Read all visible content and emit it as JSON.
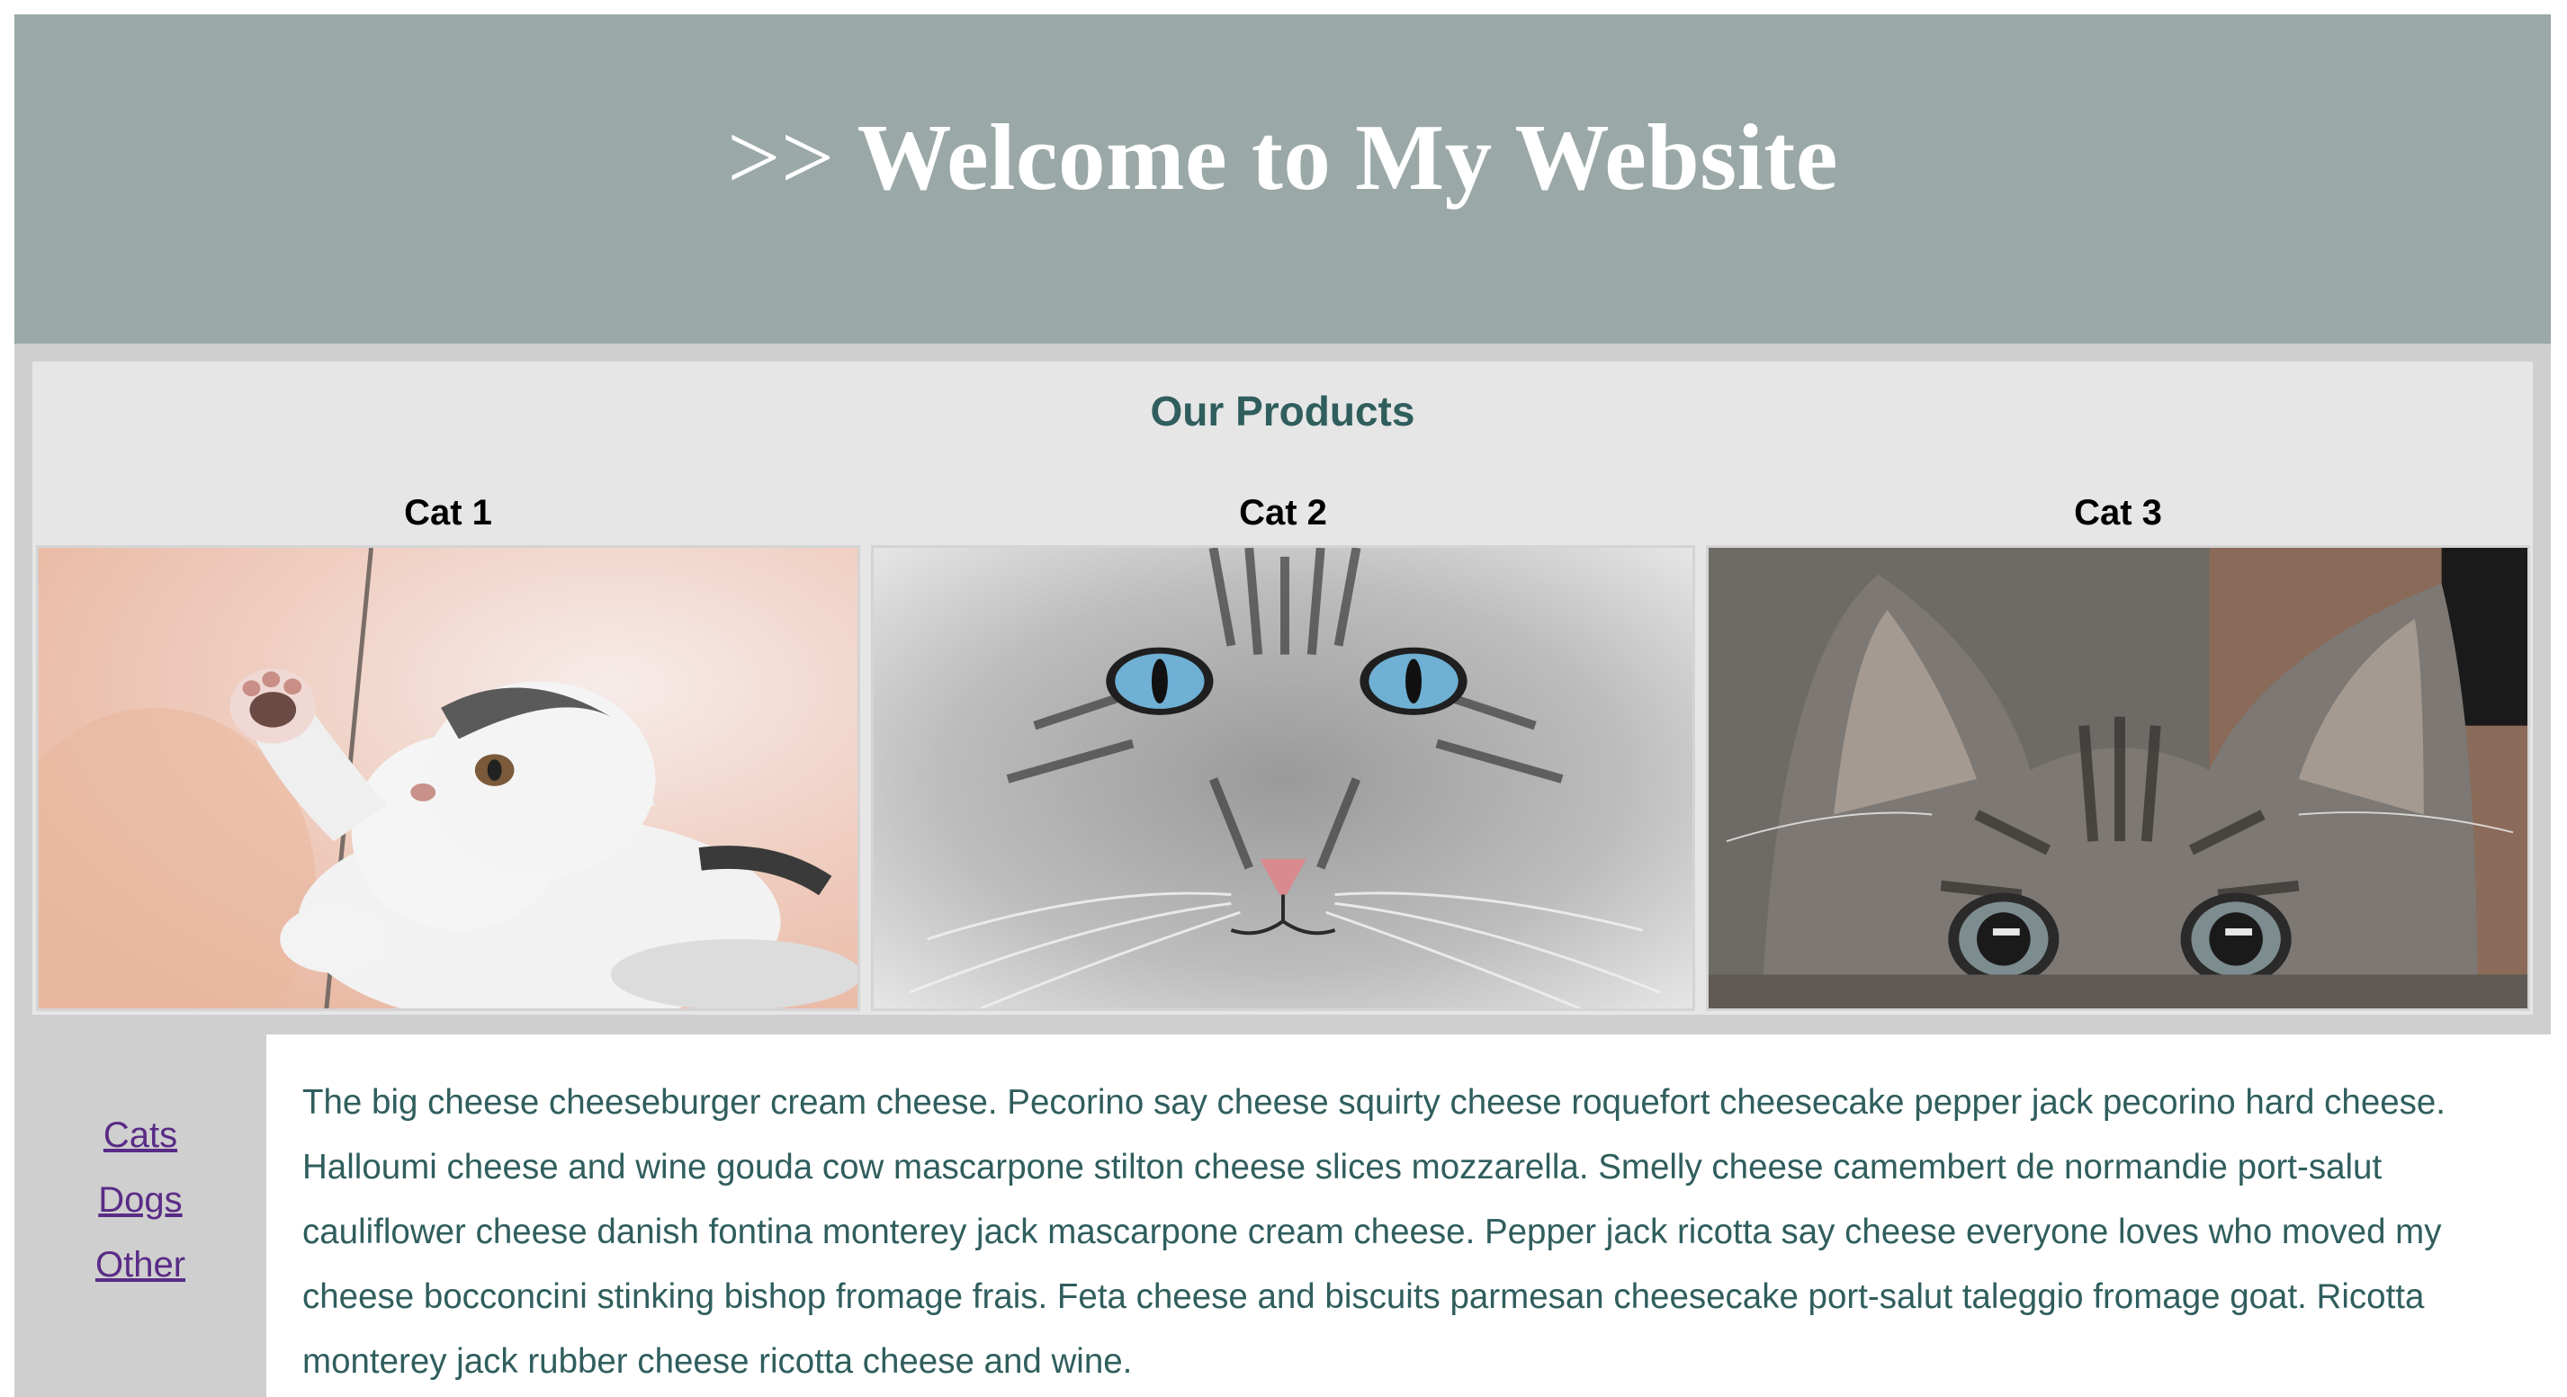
{
  "header": {
    "prefix": ">>",
    "title": "Welcome to My Website"
  },
  "products": {
    "heading": "Our Products",
    "items": [
      {
        "title": "Cat 1",
        "image": "white kitten playing with string"
      },
      {
        "title": "Cat 2",
        "image": "grey tabby cat with blue eyes"
      },
      {
        "title": "Cat 3",
        "image": "tabby kitten peeking over edge"
      }
    ]
  },
  "sidebar": {
    "links": [
      {
        "label": "Cats"
      },
      {
        "label": "Dogs"
      },
      {
        "label": "Other"
      }
    ]
  },
  "content": {
    "text": "The big cheese cheeseburger cream cheese. Pecorino say cheese squirty cheese roquefort cheesecake pepper jack pecorino hard cheese. Halloumi cheese and wine gouda cow mascarpone stilton cheese slices mozzarella. Smelly cheese camembert de normandie port-salut cauliflower cheese danish fontina monterey jack mascarpone cream cheese. Pepper jack ricotta say cheese everyone loves who moved my cheese bocconcini stinking bishop fromage frais. Feta cheese and biscuits parmesan cheesecake port-salut taleggio fromage goat. Ricotta monterey jack rubber cheese ricotta cheese and wine."
  },
  "colors": {
    "header_bg": "#9aa8a7",
    "page_bg": "#cfcfcf",
    "products_bg": "#e6e6e6",
    "heading_text": "#2f5e5d",
    "link": "#5a2b86"
  }
}
